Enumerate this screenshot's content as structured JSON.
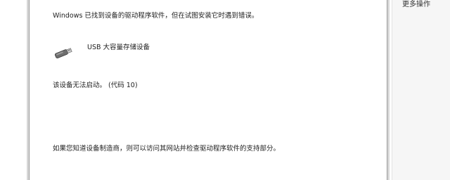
{
  "dialog": {
    "found_driver_error": "Windows 已找到设备的驱动程序软件，但在试图安装它时遇到错误。",
    "device_name": "USB 大容量存储设备",
    "device_icon": "usb-drive-icon",
    "status_message": "该设备无法启动。 (代码 10)",
    "vendor_hint": "如果您知道设备制造商，则可以访问其网站并检查驱动程序软件的支持部分。"
  },
  "actions_pane": {
    "more_actions_label": "更多操作"
  }
}
